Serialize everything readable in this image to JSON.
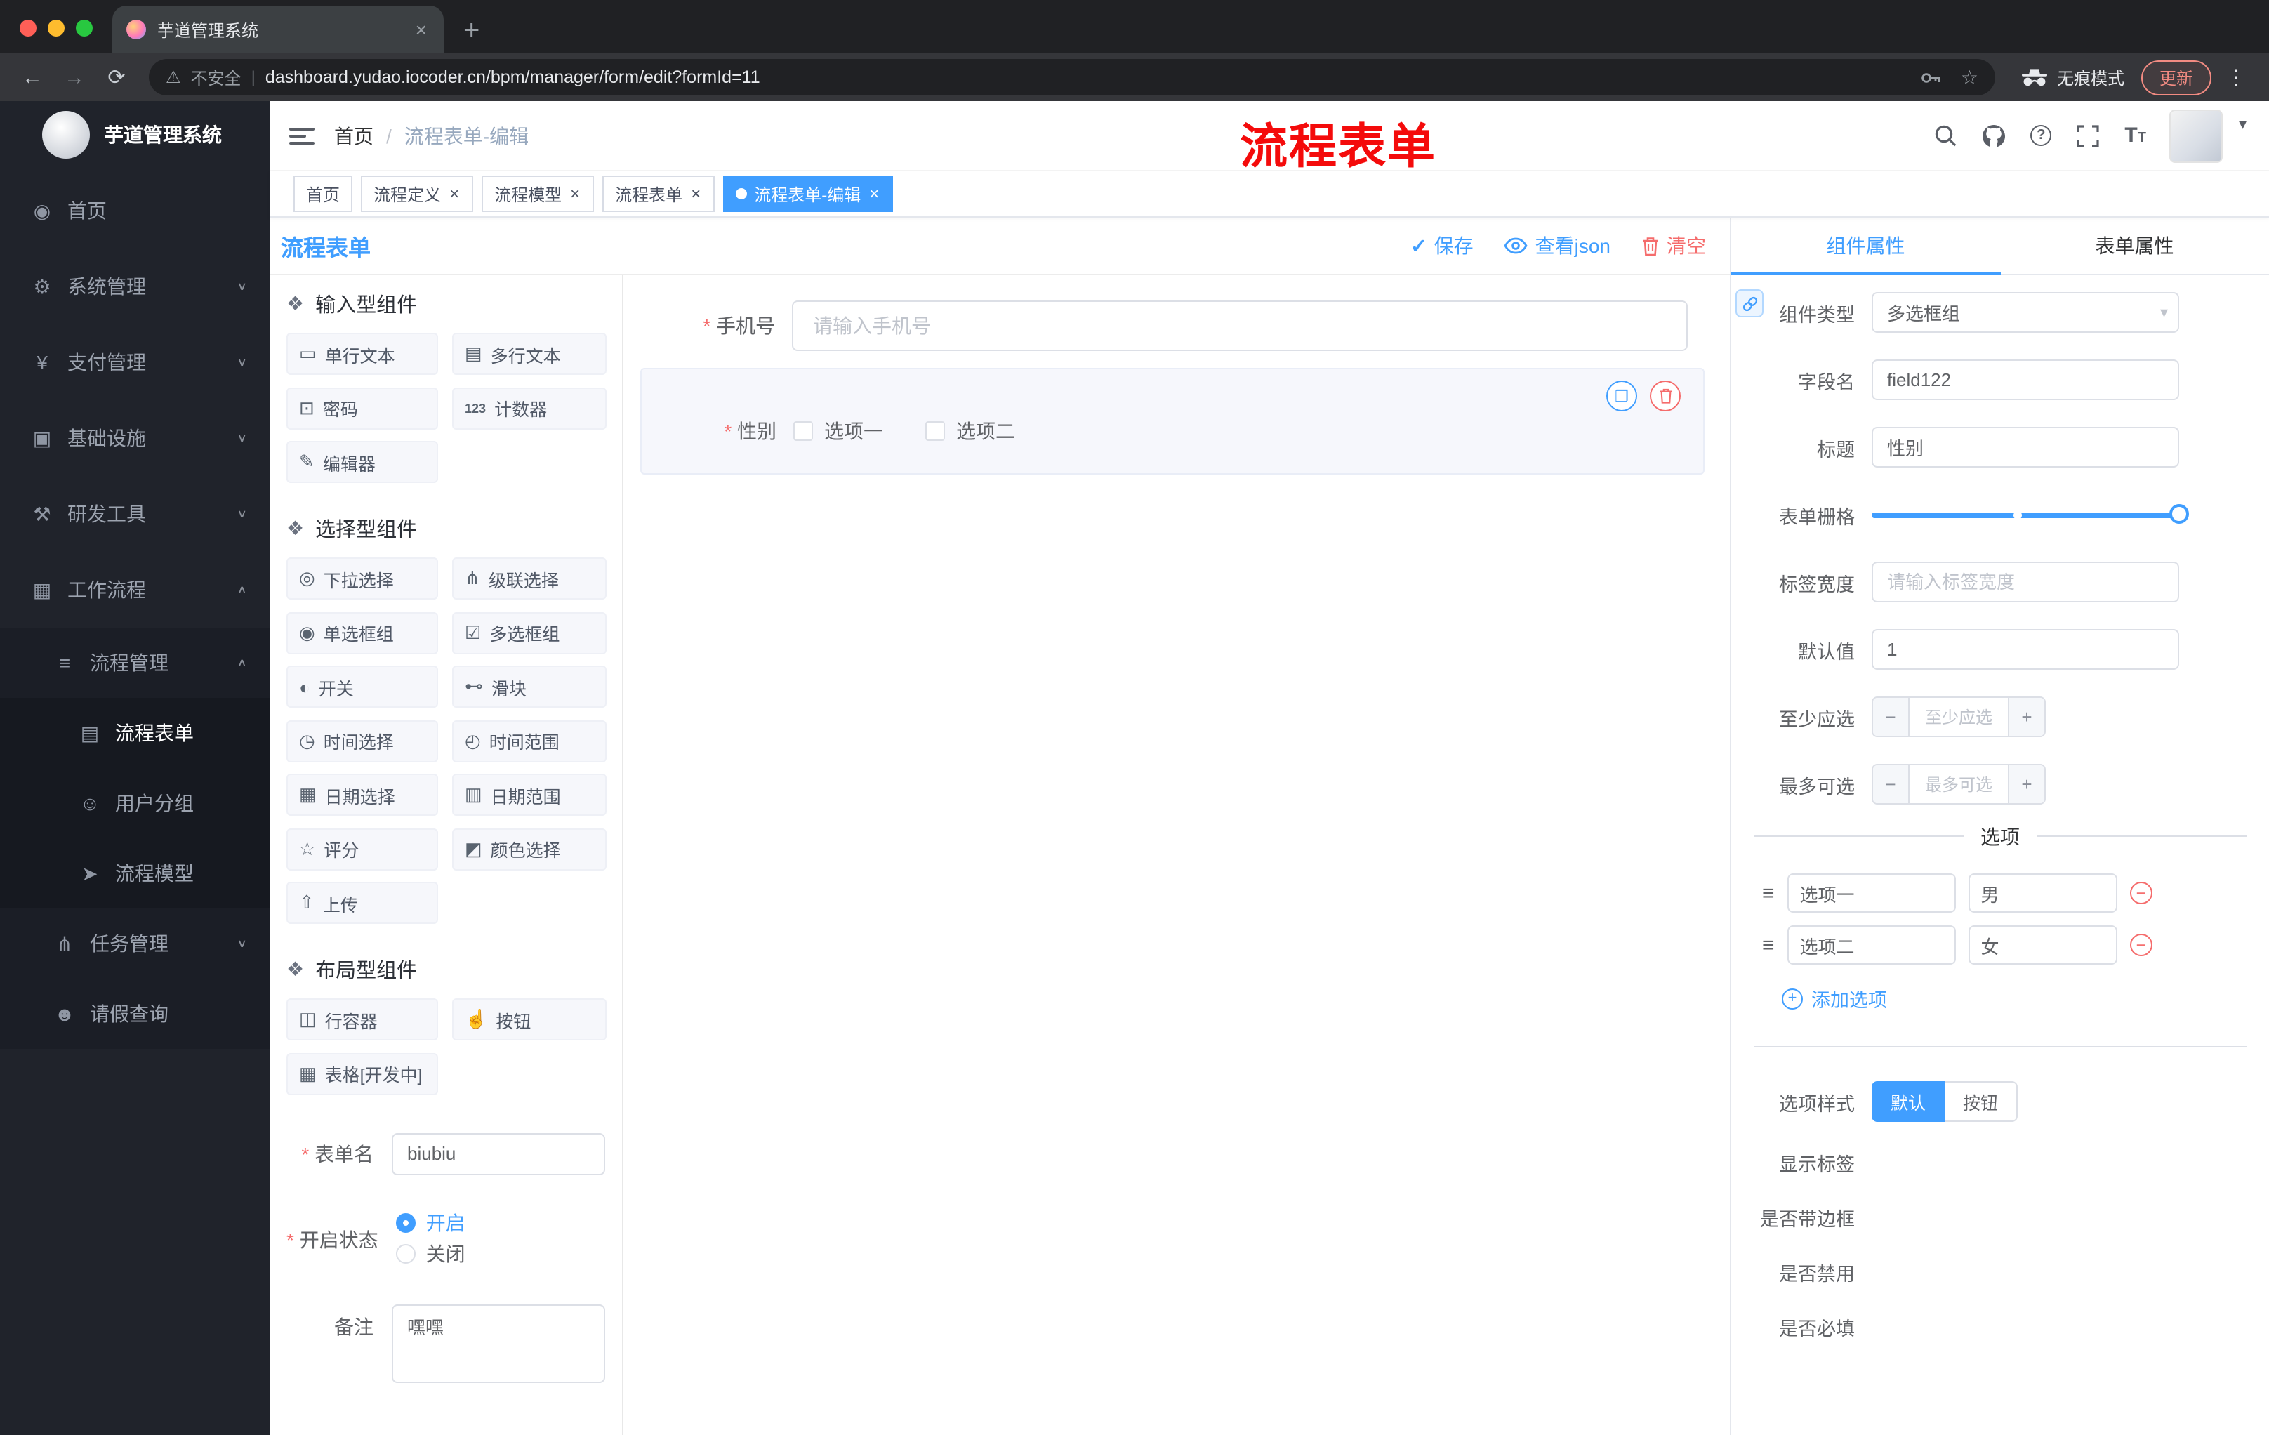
{
  "colors": {
    "accent": "#409eff",
    "danger": "#f56c6c",
    "sidebar_bg": "#20232b",
    "annotation_red": "#f40b0b"
  },
  "browser": {
    "tab_title": "芋道管理系统",
    "security_label": "不安全",
    "url": "dashboard.yudao.iocoder.cn/bpm/manager/form/edit?formId=11",
    "incognito_label": "无痕模式",
    "update_label": "更新"
  },
  "sidebar": {
    "logo_title": "芋道管理系统",
    "items": [
      {
        "icon": "dashboard-icon",
        "label": "首页",
        "level": 0
      },
      {
        "icon": "gear-icon",
        "label": "系统管理",
        "level": 0,
        "chevron": "down"
      },
      {
        "icon": "yen-icon",
        "label": "支付管理",
        "level": 0,
        "chevron": "down"
      },
      {
        "icon": "infra-icon",
        "label": "基础设施",
        "level": 0,
        "chevron": "down"
      },
      {
        "icon": "tools-icon",
        "label": "研发工具",
        "level": 0,
        "chevron": "down"
      },
      {
        "icon": "workflow-icon",
        "label": "工作流程",
        "level": 0,
        "chevron": "up"
      },
      {
        "icon": "list-icon",
        "label": "流程管理",
        "level": 1,
        "chevron": "up"
      },
      {
        "icon": "doc-icon",
        "label": "流程表单",
        "level": 2,
        "active": true
      },
      {
        "icon": "users-icon",
        "label": "用户分组",
        "level": 2
      },
      {
        "icon": "send-icon",
        "label": "流程模型",
        "level": 2
      },
      {
        "icon": "tree-icon",
        "label": "任务管理",
        "level": 1,
        "chevron": "down"
      },
      {
        "icon": "person-icon",
        "label": "请假查询",
        "level": 1
      }
    ]
  },
  "header": {
    "breadcrumb": [
      "首页",
      "流程表单-编辑"
    ],
    "annotation": "流程表单"
  },
  "tags": [
    {
      "label": "首页",
      "closable": false,
      "active": false
    },
    {
      "label": "流程定义",
      "closable": true,
      "active": false
    },
    {
      "label": "流程模型",
      "closable": true,
      "active": false
    },
    {
      "label": "流程表单",
      "closable": true,
      "active": false
    },
    {
      "label": "流程表单-编辑",
      "closable": true,
      "active": true
    }
  ],
  "page": {
    "title": "流程表单",
    "save_label": "保存",
    "view_json_label": "查看json",
    "clear_label": "清空"
  },
  "palette": {
    "sections": [
      {
        "title": "输入型组件",
        "items": [
          {
            "icon": "input-icon",
            "label": "单行文本"
          },
          {
            "icon": "textarea-icon",
            "label": "多行文本"
          },
          {
            "icon": "lock-icon",
            "label": "密码"
          },
          {
            "icon": "counter-icon",
            "label": "计数器"
          },
          {
            "icon": "editor-icon",
            "label": "编辑器"
          }
        ]
      },
      {
        "title": "选择型组件",
        "items": [
          {
            "icon": "select-icon",
            "label": "下拉选择"
          },
          {
            "icon": "cascader-icon",
            "label": "级联选择"
          },
          {
            "icon": "radio-icon",
            "label": "单选框组"
          },
          {
            "icon": "checkbox-icon",
            "label": "多选框组"
          },
          {
            "icon": "switch-icon",
            "label": "开关"
          },
          {
            "icon": "slider-icon",
            "label": "滑块"
          },
          {
            "icon": "time-icon",
            "label": "时间选择"
          },
          {
            "icon": "time-range-icon",
            "label": "时间范围"
          },
          {
            "icon": "date-icon",
            "label": "日期选择"
          },
          {
            "icon": "date-range-icon",
            "label": "日期范围"
          },
          {
            "icon": "rate-icon",
            "label": "评分"
          },
          {
            "icon": "color-icon",
            "label": "颜色选择"
          },
          {
            "icon": "upload-icon",
            "label": "上传"
          }
        ]
      },
      {
        "title": "布局型组件",
        "items": [
          {
            "icon": "row-icon",
            "label": "行容器"
          },
          {
            "icon": "button-icon",
            "label": "按钮"
          },
          {
            "icon": "table-icon",
            "label": "表格[开发中]"
          }
        ]
      }
    ],
    "form": {
      "name_label": "表单名",
      "name_value": "biubiu",
      "status_label": "开启状态",
      "status_on": "开启",
      "status_off": "关闭",
      "remark_label": "备注",
      "remark_value": "嘿嘿"
    }
  },
  "canvas": {
    "phone": {
      "label": "手机号",
      "placeholder": "请输入手机号"
    },
    "gender": {
      "label": "性别",
      "options": [
        "选项一",
        "选项二"
      ]
    }
  },
  "inspector": {
    "tabs": [
      "组件属性",
      "表单属性"
    ],
    "component_type_label": "组件类型",
    "component_type_value": "多选框组",
    "field_label": "字段名",
    "field_value": "field122",
    "title_label": "标题",
    "title_value": "性别",
    "grid_label": "表单栅格",
    "label_width_label": "标签宽度",
    "label_width_placeholder": "请输入标签宽度",
    "default_label": "默认值",
    "default_value": "1",
    "min_label": "至少应选",
    "min_placeholder": "至少应选",
    "max_label": "最多可选",
    "max_placeholder": "最多可选",
    "options_title": "选项",
    "options": [
      {
        "label": "选项一",
        "value": "男"
      },
      {
        "label": "选项二",
        "value": "女"
      }
    ],
    "add_option_label": "添加选项",
    "style_label": "选项样式",
    "style_default": "默认",
    "style_button": "按钮",
    "switches": [
      {
        "label": "显示标签",
        "on": true
      },
      {
        "label": "是否带边框",
        "on": false
      },
      {
        "label": "是否禁用",
        "on": false
      },
      {
        "label": "是否必填",
        "on": true
      }
    ]
  }
}
